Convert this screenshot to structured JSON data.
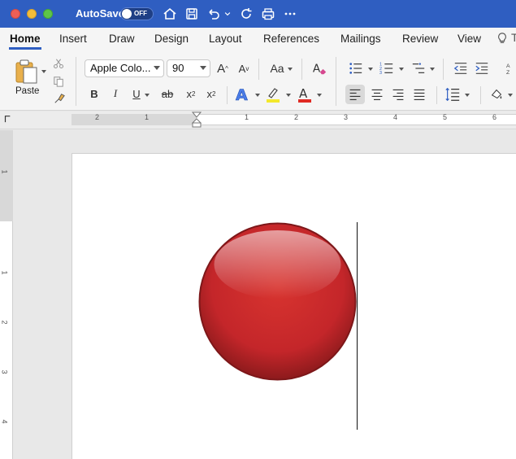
{
  "titlebar": {
    "autosave_label": "AutoSave",
    "autosave_state": "OFF"
  },
  "tabs": [
    {
      "label": "Home",
      "active": true
    },
    {
      "label": "Insert"
    },
    {
      "label": "Draw"
    },
    {
      "label": "Design"
    },
    {
      "label": "Layout"
    },
    {
      "label": "References"
    },
    {
      "label": "Mailings"
    },
    {
      "label": "Review"
    },
    {
      "label": "View"
    }
  ],
  "ribbon": {
    "paste_label": "Paste",
    "font_name": "Apple Colo...",
    "font_size": "90",
    "bold": "B",
    "italic": "I",
    "underline": "U",
    "strike": "ab",
    "subscript": "x",
    "superscript": "x",
    "change_case": "Aa",
    "grow_font": "A",
    "shrink_font": "A"
  },
  "ruler": {
    "numbers": [
      "2",
      "1",
      "1",
      "2",
      "3",
      "4",
      "5",
      "6"
    ]
  },
  "vruler": {
    "numbers": [
      "1",
      "1",
      "2",
      "3",
      "4"
    ]
  },
  "colors": {
    "titlebar": "#2f5ec1",
    "ball": "#c4262a",
    "highlight": "#f3e82c",
    "font_color": "#e02a24"
  }
}
